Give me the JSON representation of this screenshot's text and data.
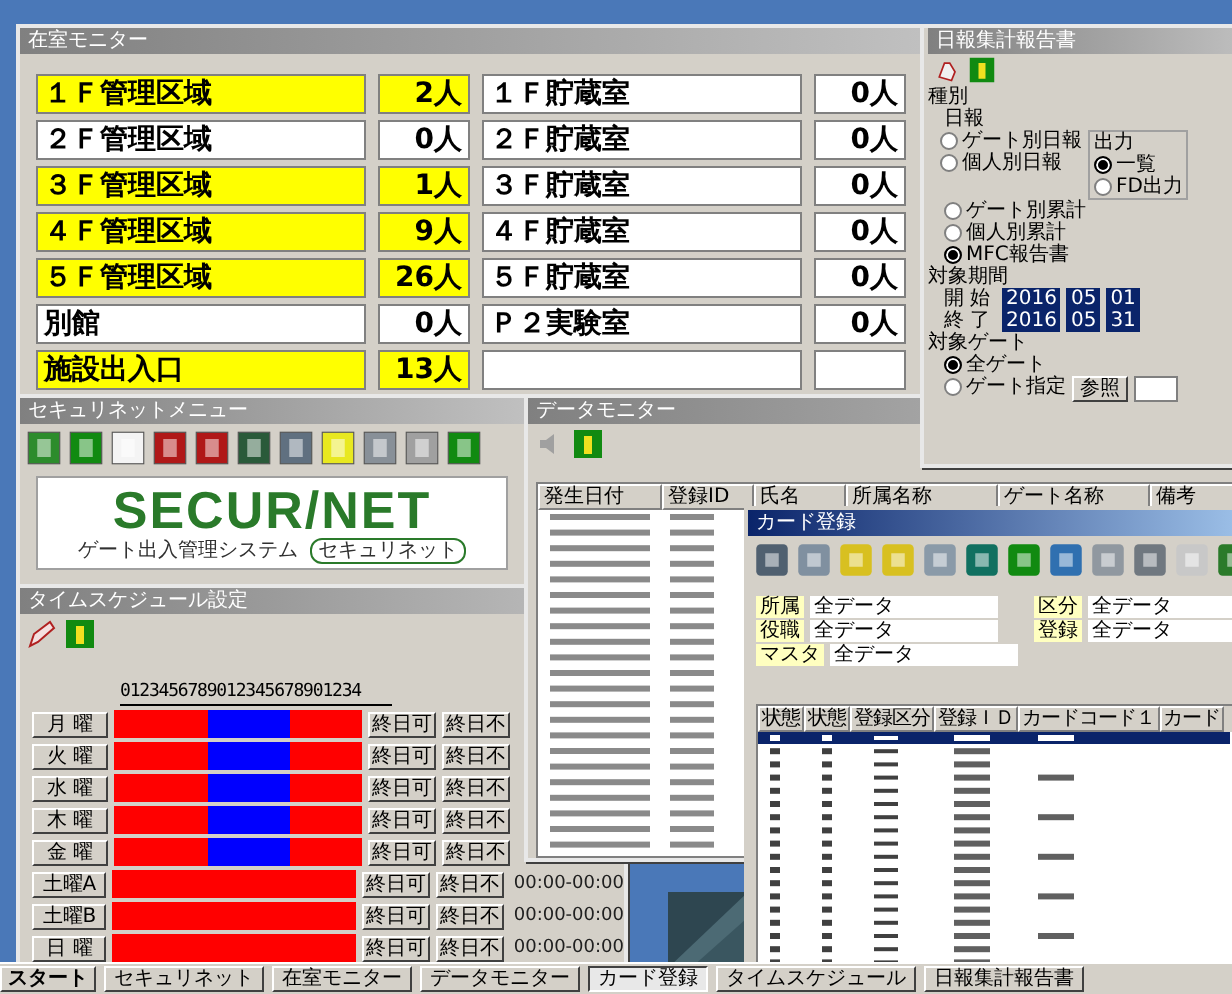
{
  "occupancy_window": {
    "title": "在室モニター",
    "areas": [
      {
        "name": "１Ｆ管理区域",
        "count": "2人",
        "occupied": true
      },
      {
        "name": "１Ｆ貯蔵室",
        "count": "0人",
        "occupied": false
      },
      {
        "name": "２Ｆ管理区域",
        "count": "0人",
        "occupied": false
      },
      {
        "name": "２Ｆ貯蔵室",
        "count": "0人",
        "occupied": false
      },
      {
        "name": "３Ｆ管理区域",
        "count": "1人",
        "occupied": true
      },
      {
        "name": "３Ｆ貯蔵室",
        "count": "0人",
        "occupied": false
      },
      {
        "name": "４Ｆ管理区域",
        "count": "9人",
        "occupied": true
      },
      {
        "name": "４Ｆ貯蔵室",
        "count": "0人",
        "occupied": false
      },
      {
        "name": "５Ｆ管理区域",
        "count": "26人",
        "occupied": true
      },
      {
        "name": "５Ｆ貯蔵室",
        "count": "0人",
        "occupied": false
      },
      {
        "name": "別館",
        "count": "0人",
        "occupied": false
      },
      {
        "name": "Ｐ２実験室",
        "count": "0人",
        "occupied": false
      },
      {
        "name": "施設出入口",
        "count": "13人",
        "occupied": true
      }
    ]
  },
  "report_window": {
    "title": "日報集計報告書",
    "type_label": "種別",
    "daily_label": "日報",
    "options": [
      {
        "label": "ゲート別日報",
        "selected": false
      },
      {
        "label": "個人別日報",
        "selected": false
      },
      {
        "label": "ゲート別累計",
        "selected": false
      },
      {
        "label": "個人別累計",
        "selected": false
      },
      {
        "label": "MFC報告書",
        "selected": true
      }
    ],
    "output_label": "出力",
    "outputs": [
      {
        "label": "一覧",
        "selected": true
      },
      {
        "label": "FD出力",
        "selected": false
      }
    ],
    "period_label": "対象期間",
    "period": [
      {
        "label": "開 始",
        "year": "2016",
        "month": "05",
        "day": "01"
      },
      {
        "label": "終 了",
        "year": "2016",
        "month": "05",
        "day": "31"
      }
    ],
    "gate_label": "対象ゲート",
    "gates": [
      {
        "label": "全ゲート",
        "selected": true
      },
      {
        "label": "ゲート指定",
        "selected": false
      }
    ],
    "browse_button": "参照"
  },
  "menu_window": {
    "title": "セキュリネットメニュー",
    "logo": "SECUR/NET",
    "logo_subtitle": "ゲート出入管理システム",
    "logo_badge": "セキュリネット"
  },
  "schedule_window": {
    "title": "タイムスケジュール設定",
    "hour_ruler": "0123456789012345678901234",
    "days": [
      {
        "label": "月 曜",
        "daytime_access": true,
        "allow_button": "終日可",
        "deny_button": "終日不"
      },
      {
        "label": "火 曜",
        "daytime_access": true,
        "allow_button": "終日可",
        "deny_button": "終日不"
      },
      {
        "label": "水 曜",
        "daytime_access": true,
        "allow_button": "終日可",
        "deny_button": "終日不"
      },
      {
        "label": "木 曜",
        "daytime_access": true,
        "allow_button": "終日可",
        "deny_button": "終日不"
      },
      {
        "label": "金 曜",
        "daytime_access": true,
        "allow_button": "終日可",
        "deny_button": "終日不"
      },
      {
        "label": "土曜A",
        "daytime_access": false,
        "allow_button": "終日可",
        "deny_button": "終日不",
        "time": "00:00-00:00"
      },
      {
        "label": "土曜B",
        "daytime_access": false,
        "allow_button": "終日可",
        "deny_button": "終日不",
        "time": "00:00-00:00"
      },
      {
        "label": "日 曜",
        "daytime_access": false,
        "allow_button": "終日可",
        "deny_button": "終日不",
        "time": "00:00-00:00"
      }
    ]
  },
  "data_window": {
    "title": "データモニター",
    "columns": [
      "発生日付",
      "登録ID",
      "氏名",
      "所属名称",
      "ゲート名称",
      "備考"
    ]
  },
  "card_window": {
    "title": "カード登録",
    "filters": [
      {
        "label": "所属",
        "value": "全データ"
      },
      {
        "label": "役職",
        "value": "全データ"
      },
      {
        "label": "マスタ",
        "value": "全データ"
      }
    ],
    "filters_right": [
      {
        "label": "区分",
        "value": "全データ"
      },
      {
        "label": "登録",
        "value": "全データ"
      }
    ],
    "columns": [
      "状態",
      "状態",
      "登録区分",
      "登録ＩＤ",
      "カードコード１",
      "カード"
    ]
  },
  "taskbar": {
    "start": "スタート",
    "items": [
      {
        "label": "セキュリネット",
        "selected": false
      },
      {
        "label": "在室モニター",
        "selected": false
      },
      {
        "label": "データモニター",
        "selected": false
      },
      {
        "label": "カード登録",
        "selected": true
      },
      {
        "label": "タイムスケジュール",
        "selected": false
      },
      {
        "label": "日報集計報告書",
        "selected": false
      }
    ]
  }
}
